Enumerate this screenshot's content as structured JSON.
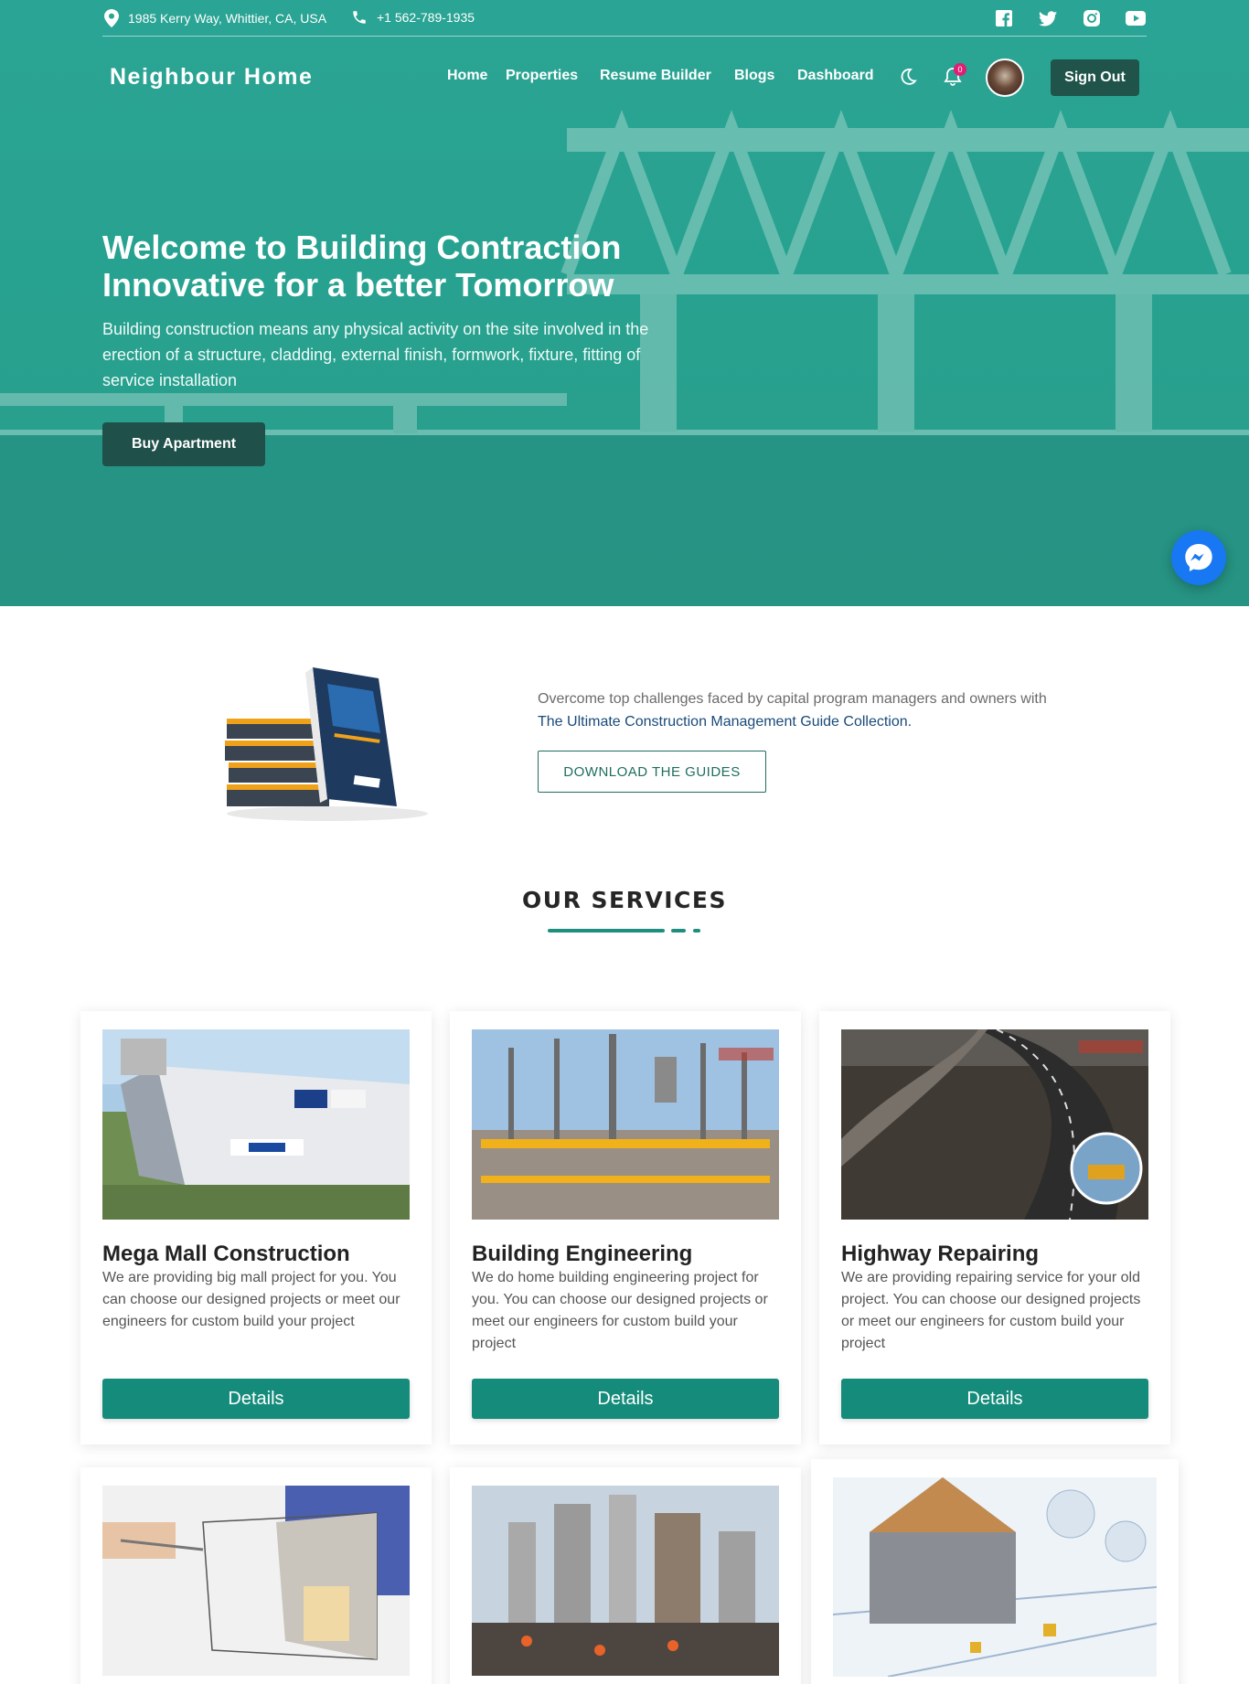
{
  "topbar": {
    "address": "1985 Kerry Way, Whittier, CA, USA",
    "phone": "+1 562-789-1935"
  },
  "header": {
    "brand": "Neighbour Home",
    "nav": [
      "Home",
      "Properties",
      "Resume Builder",
      "Blogs",
      "Dashboard"
    ],
    "notification_count": "0",
    "sign_out_label": "Sign Out"
  },
  "hero": {
    "title": "Welcome to Building Contraction Innovative for a better Tomorrow",
    "description": "Building construction means any physical activity on the site involved in the erection of a structure, cladding, external finish, formwork, fixture, fitting of service installation",
    "cta_label": "Buy Apartment"
  },
  "guide": {
    "text": "Overcome top challenges faced by capital program managers and owners with",
    "link_text": "The Ultimate Construction Management Guide Collection.",
    "button_label": "DOWNLOAD THE GUIDES"
  },
  "services": {
    "title": "OUR SERVICES",
    "cards": [
      {
        "title": "Mega Mall Construction",
        "description": "We are providing big mall project for you. You can choose our designed projects or meet our engineers for custom build your project",
        "button": "Details"
      },
      {
        "title": "Building Engineering",
        "description": "We do home building engineering project for you. You can choose our designed projects or meet our engineers for custom build your project",
        "button": "Details"
      },
      {
        "title": "Highway Repairing",
        "description": "We are providing repairing service for your old project. You can choose our designed projects or meet our engineers for custom build your project",
        "button": "Details"
      }
    ]
  },
  "colors": {
    "hero_teal": "#2aa494",
    "dark_button": "#1f5049",
    "accent": "#158c7b",
    "messenger": "#1877f2",
    "badge": "#e11d74"
  },
  "icons": {
    "topbar": [
      "location-pin-icon",
      "phone-icon"
    ],
    "social": [
      "facebook-icon",
      "twitter-icon",
      "instagram-icon",
      "youtube-icon"
    ],
    "header": [
      "moon-icon",
      "bell-icon"
    ],
    "floating": "messenger-icon"
  }
}
